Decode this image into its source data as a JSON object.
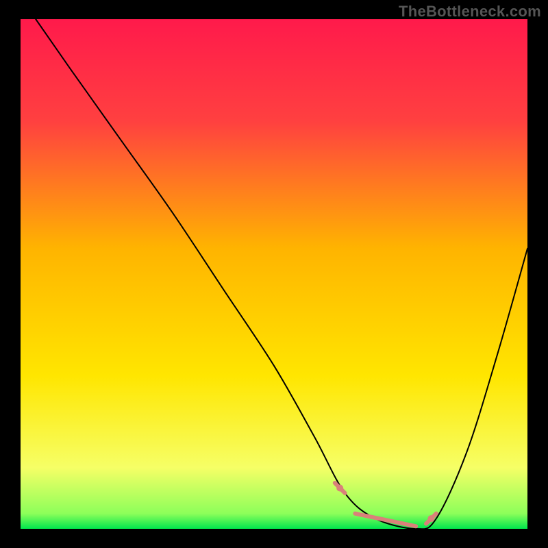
{
  "watermark": "TheBottleneck.com",
  "chart_data": {
    "type": "line",
    "title": "",
    "xlabel": "",
    "ylabel": "",
    "xlim": [
      0,
      100
    ],
    "ylim": [
      0,
      100
    ],
    "grid": false,
    "legend": false,
    "background_gradient": {
      "stops": [
        {
          "offset": 0.0,
          "color": "#ff1a4b"
        },
        {
          "offset": 0.2,
          "color": "#ff4040"
        },
        {
          "offset": 0.45,
          "color": "#ffb400"
        },
        {
          "offset": 0.7,
          "color": "#ffe600"
        },
        {
          "offset": 0.88,
          "color": "#f6ff66"
        },
        {
          "offset": 0.97,
          "color": "#8dff5a"
        },
        {
          "offset": 1.0,
          "color": "#00e64d"
        }
      ]
    },
    "series": [
      {
        "name": "bottleneck-curve",
        "color": "#000000",
        "stroke_width": 2,
        "x": [
          3,
          10,
          20,
          30,
          40,
          50,
          58,
          64,
          70,
          78,
          82,
          88,
          94,
          100
        ],
        "y": [
          100,
          90,
          76,
          62,
          47,
          32,
          18,
          7,
          2,
          0,
          2,
          15,
          34,
          55
        ]
      }
    ],
    "highlight": {
      "name": "optimal-range",
      "color": "#d9817a",
      "stroke_width": 6,
      "segments": [
        {
          "x": [
            62,
            64
          ],
          "y": [
            9,
            7
          ]
        },
        {
          "x": [
            66,
            78
          ],
          "y": [
            3,
            0.5
          ]
        },
        {
          "x": [
            80,
            82
          ],
          "y": [
            1,
            3
          ]
        }
      ],
      "dots": [
        {
          "x": 63,
          "y": 8
        },
        {
          "x": 81,
          "y": 2
        }
      ]
    },
    "border_color": "#000000"
  }
}
